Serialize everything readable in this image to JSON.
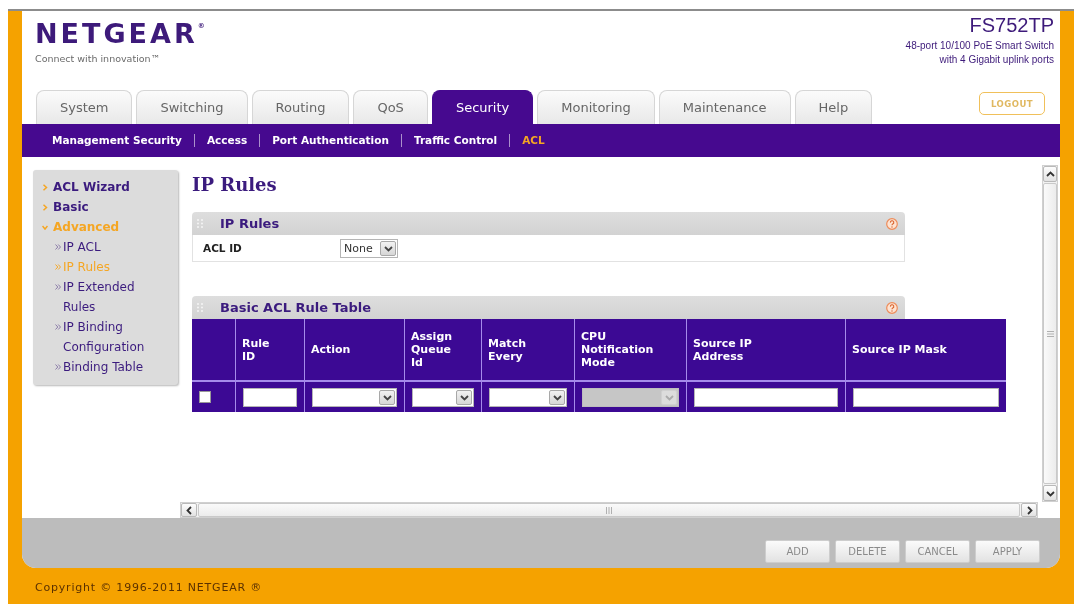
{
  "header": {
    "logo": "NETGEAR$^{®}$",
    "tagline": "Connect with innovation™",
    "model": "FS752TP",
    "description": [
      "48-port 10/100 PoE Smart Switch",
      "with 4 Gigabit uplink ports"
    ]
  },
  "tabs": [
    {
      "label": "System",
      "selected": false
    },
    {
      "label": "Switching",
      "selected": false
    },
    {
      "label": "Routing",
      "selected": false
    },
    {
      "label": "QoS",
      "selected": false
    },
    {
      "label": "Security",
      "selected": true
    },
    {
      "label": "Monitoring",
      "selected": false
    },
    {
      "label": "Maintenance",
      "selected": false
    },
    {
      "label": "Help",
      "selected": false
    }
  ],
  "logout_button": "LOGOUT",
  "subtabs": [
    {
      "label": "Management Security",
      "selected": false
    },
    {
      "label": "Access",
      "selected": false
    },
    {
      "label": "Port Authentication",
      "selected": false
    },
    {
      "label": "Traffic Control",
      "selected": false
    },
    {
      "label": "ACL",
      "selected": true
    }
  ],
  "sidebar": {
    "items": [
      {
        "label": "ACL Wizard",
        "selected": false,
        "expanded": false
      },
      {
        "label": "Basic",
        "selected": false,
        "expanded": false
      },
      {
        "label": "Advanced",
        "selected": true,
        "expanded": true,
        "children": [
          {
            "label": "IP ACL",
            "selected": false
          },
          {
            "label": "IP Rules",
            "selected": true
          },
          {
            "label": "IP Extended Rules",
            "selected": false
          },
          {
            "label": "IP Binding Configuration",
            "selected": false
          },
          {
            "label": "Binding Table",
            "selected": false
          }
        ]
      }
    ]
  },
  "page_title": "IP Rules",
  "panels": [
    {
      "kind": "form",
      "title": "IP Rules",
      "fields": [
        {
          "kind": "select",
          "label": "ACL ID",
          "value": "None"
        }
      ]
    },
    {
      "kind": "table",
      "title": "Basic ACL Rule Table",
      "columns": [
        "Rule ID",
        "Action",
        "Assign Queue Id",
        "Match Every",
        "CPU Notification Mode",
        "Source IP Address",
        "Source IP Mask"
      ],
      "rows": [
        {
          "checked": false,
          "cells": [
            {
              "kind": "input",
              "disabled": false
            },
            {
              "kind": "select",
              "disabled": false
            },
            {
              "kind": "select",
              "disabled": false
            },
            {
              "kind": "select",
              "disabled": false
            },
            {
              "kind": "select",
              "disabled": true
            },
            {
              "kind": "input",
              "disabled": false
            },
            {
              "kind": "input",
              "disabled": false
            }
          ]
        }
      ]
    }
  ],
  "buttons": [
    "ADD",
    "DELETE",
    "CANCEL",
    "APPLY"
  ],
  "footer": "Copyright © 1996-2011 NETGEAR ®"
}
